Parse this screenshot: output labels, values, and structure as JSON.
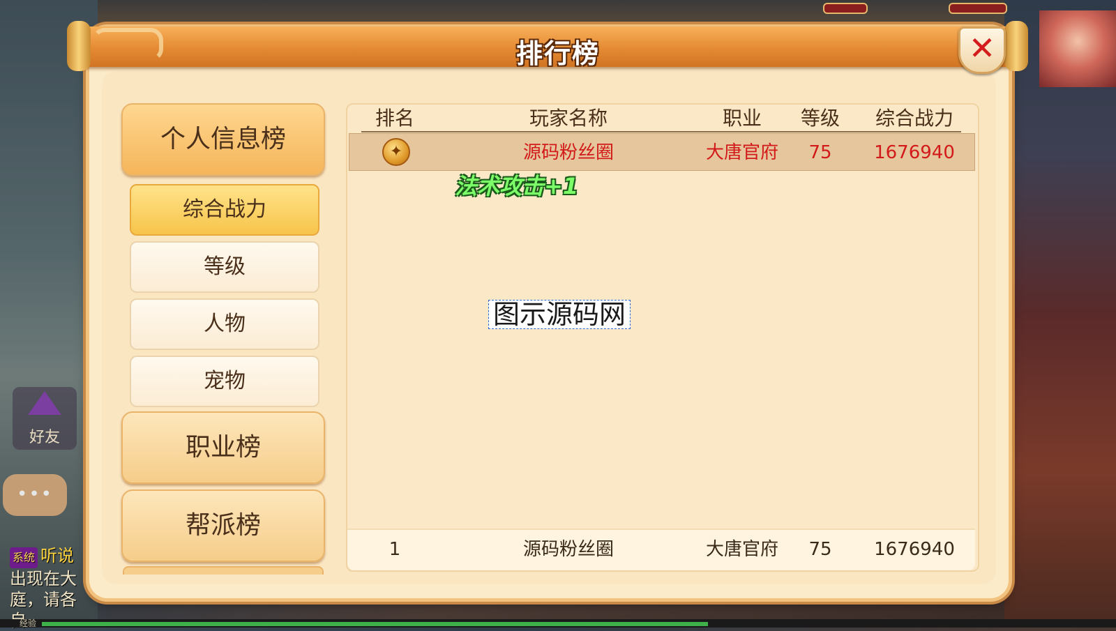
{
  "title": "排行榜",
  "nav": {
    "main": [
      {
        "label": "个人信息榜",
        "active": true
      },
      {
        "label": "职业榜",
        "active": false
      },
      {
        "label": "帮派榜",
        "active": false
      }
    ],
    "sub": [
      {
        "label": "综合战力",
        "active": true
      },
      {
        "label": "等级",
        "active": false
      },
      {
        "label": "人物",
        "active": false
      },
      {
        "label": "宠物",
        "active": false
      }
    ]
  },
  "table": {
    "headers": [
      "排名",
      "玩家名称",
      "职业",
      "等级",
      "综合战力"
    ],
    "rows": [
      {
        "rank_icon": "gold-medal-icon",
        "name": "源码粉丝圈",
        "class": "大唐官府",
        "level": "75",
        "power": "1676940"
      }
    ],
    "footer": {
      "rank": "1",
      "name": "源码粉丝圈",
      "class": "大唐官府",
      "level": "75",
      "power": "1676940"
    }
  },
  "floating_text": "法术攻击+1",
  "watermark": "图示源码网",
  "side_ui": {
    "friend_label": "好友",
    "chat_dots": "•••",
    "chat_tag": "系统",
    "chat_text_1": "听说",
    "chat_text_2": "出现在大",
    "chat_text_3": "庭，请各自",
    "exp_label": "经验"
  },
  "exp_progress": 0.62,
  "colors": {
    "accent_orange": "#e48a33",
    "highlight_red": "#d21a1a",
    "panel_bg": "#fcebc9",
    "float_green": "#7dff6a"
  }
}
